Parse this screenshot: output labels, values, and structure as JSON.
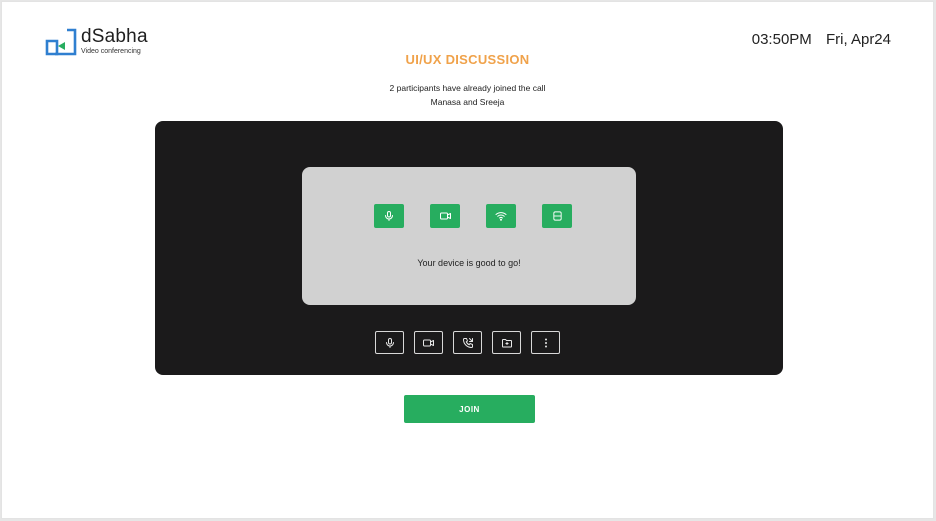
{
  "brand": {
    "name": "dSabha",
    "tagline": "Video conferencing"
  },
  "clock": {
    "time": "03:50PM",
    "date": "Fri, Apr24"
  },
  "meeting": {
    "title": "UI/UX DISCUSSION",
    "participants_text": "2 participants have already joined the call",
    "participant_names": "Manasa and Sreeja"
  },
  "device_check": {
    "status_icons": [
      "microphone-icon",
      "camera-icon",
      "wifi-icon",
      "storage-icon"
    ],
    "message": "Your device is good to go!"
  },
  "controls": [
    "microphone-icon",
    "video-camera-icon",
    "phone-call-icon",
    "folder-add-icon",
    "more-vertical-icon"
  ],
  "join": {
    "label": "JOIN"
  },
  "colors": {
    "accent_green": "#27ad5f",
    "title_orange": "#f0a24a",
    "stage_bg": "#1b1a1b",
    "logo_blue": "#2f7fd0"
  }
}
